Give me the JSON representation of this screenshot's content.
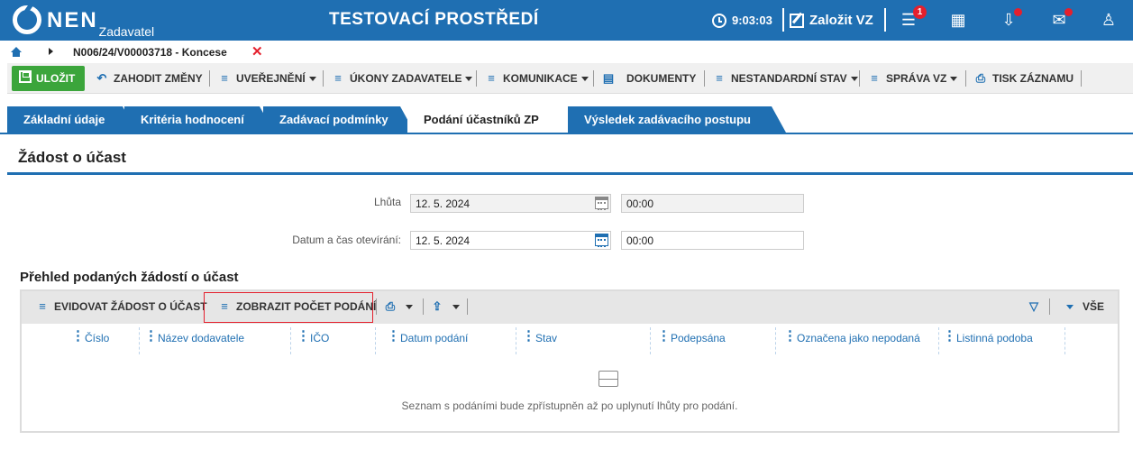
{
  "header": {
    "logo_text": "NEN",
    "logo_sub": "Zadavatel",
    "environment": "TESTOVACÍ PROSTŘEDÍ",
    "clock": "9:03:03",
    "create_label": "Založit VZ",
    "notification_count": "1"
  },
  "breadcrumb": {
    "item": "N006/24/V00003718 - Koncese"
  },
  "toolbar": {
    "save": "ULOŽIT",
    "discard": "ZAHODIT ZMĚNY",
    "publish": "UVEŘEJNĚNÍ",
    "actions": "ÚKONY ZADAVATELE",
    "communication": "KOMUNIKACE",
    "documents": "DOKUMENTY",
    "nonstandard": "NESTANDARDNÍ STAV",
    "management": "SPRÁVA VZ",
    "print": "TISK ZÁZNAMU"
  },
  "tabs": [
    {
      "label": "Základní údaje"
    },
    {
      "label": "Kritéria hodnocení"
    },
    {
      "label": "Zadávací podmínky"
    },
    {
      "label": "Podání účastníků ZP"
    },
    {
      "label": "Výsledek zadávacího postupu"
    }
  ],
  "section": {
    "title": "Žádost o účast"
  },
  "form": {
    "deadline_label": "Lhůta",
    "deadline_date": "12. 5. 2024",
    "deadline_time": "00:00",
    "opening_label": "Datum a čas otevírání:",
    "opening_date": "12. 5. 2024",
    "opening_time": "00:00"
  },
  "grid": {
    "title": "Přehled podaných žádostí o účast",
    "btn_register": "EVIDOVAT ŽÁDOST O ÚČAST",
    "btn_count": "ZOBRAZIT POČET PODÁNÍ",
    "filter_all": "VŠE",
    "columns": [
      "Číslo",
      "Název dodavatele",
      "IČO",
      "Datum podání",
      "Stav",
      "Podepsána",
      "Označena jako nepodaná",
      "Listinná podoba"
    ],
    "empty_message": "Seznam s podáními bude zpřístupněn až po uplynutí lhůty pro podání."
  },
  "colors": {
    "primary": "#1f6fb2",
    "save_green": "#3ba53b",
    "alert_red": "#e4202d"
  }
}
